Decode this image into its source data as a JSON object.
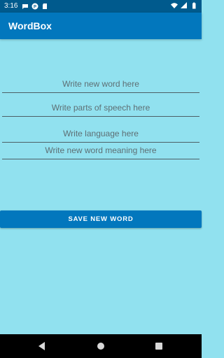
{
  "status_bar": {
    "time": "3:16",
    "left_icons": [
      "message-icon",
      "notification-icon",
      "sd-card-icon"
    ],
    "right_icons": [
      "wifi-icon",
      "signal-icon",
      "battery-icon"
    ]
  },
  "app_bar": {
    "title": "WordBox"
  },
  "form": {
    "word_placeholder": "Write new word here",
    "word_value": "",
    "pos_placeholder": "Write parts of speech here",
    "pos_value": "",
    "language_placeholder": "Write language here",
    "language_value": "",
    "meaning_placeholder": "Write new word meaning here",
    "meaning_value": "",
    "save_label": "SAVE NEW WORD"
  },
  "nav_bar": {
    "icons": [
      "back-icon",
      "home-icon",
      "recents-icon"
    ]
  },
  "colors": {
    "background": "#91e1ef",
    "app_bar": "#0277bd",
    "status_bar": "#005a8d",
    "button": "#0277bd"
  }
}
